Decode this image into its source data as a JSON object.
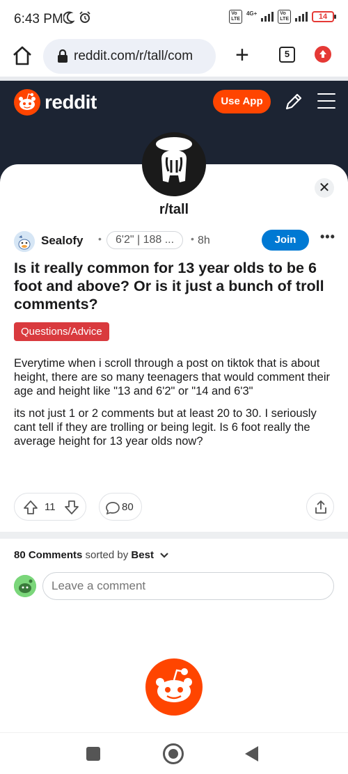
{
  "status_bar": {
    "time": "6:43 PM",
    "network_label": "4G+",
    "battery": "14"
  },
  "browser": {
    "url": "reddit.com/r/tall/com",
    "tab_count": "5"
  },
  "reddit_header": {
    "logo_text": "reddit",
    "use_app_label": "Use App",
    "brand_color": "#ff4500"
  },
  "subreddit": {
    "name": "r/tall",
    "close_icon": "✕"
  },
  "post": {
    "username": "Sealofy",
    "user_flair": "6'2\" | 188 ...",
    "time": "8h",
    "join_label": "Join",
    "more_label": "•••",
    "title": "Is it really common for 13 year olds to be 6 foot and above? Or is it just a bunch of troll comments?",
    "flair": "Questions/Advice",
    "body": [
      "Everytime when i scroll through a post on tiktok that is about height, there are so many teenagers that would comment their age and height like \"13 and 6'2\" or \"14 and 6'3\"",
      "its not just 1 or 2 comments but at least 20 to 30. I seriously cant tell if they are trolling or being legit. Is 6 foot really the average height for 13 year olds now?"
    ],
    "vote_count": "11",
    "comment_count": "80"
  },
  "comments": {
    "count_label": "80 Comments",
    "sorted_by_label": "sorted by",
    "sort_value": "Best",
    "input_placeholder": "Leave a comment"
  }
}
